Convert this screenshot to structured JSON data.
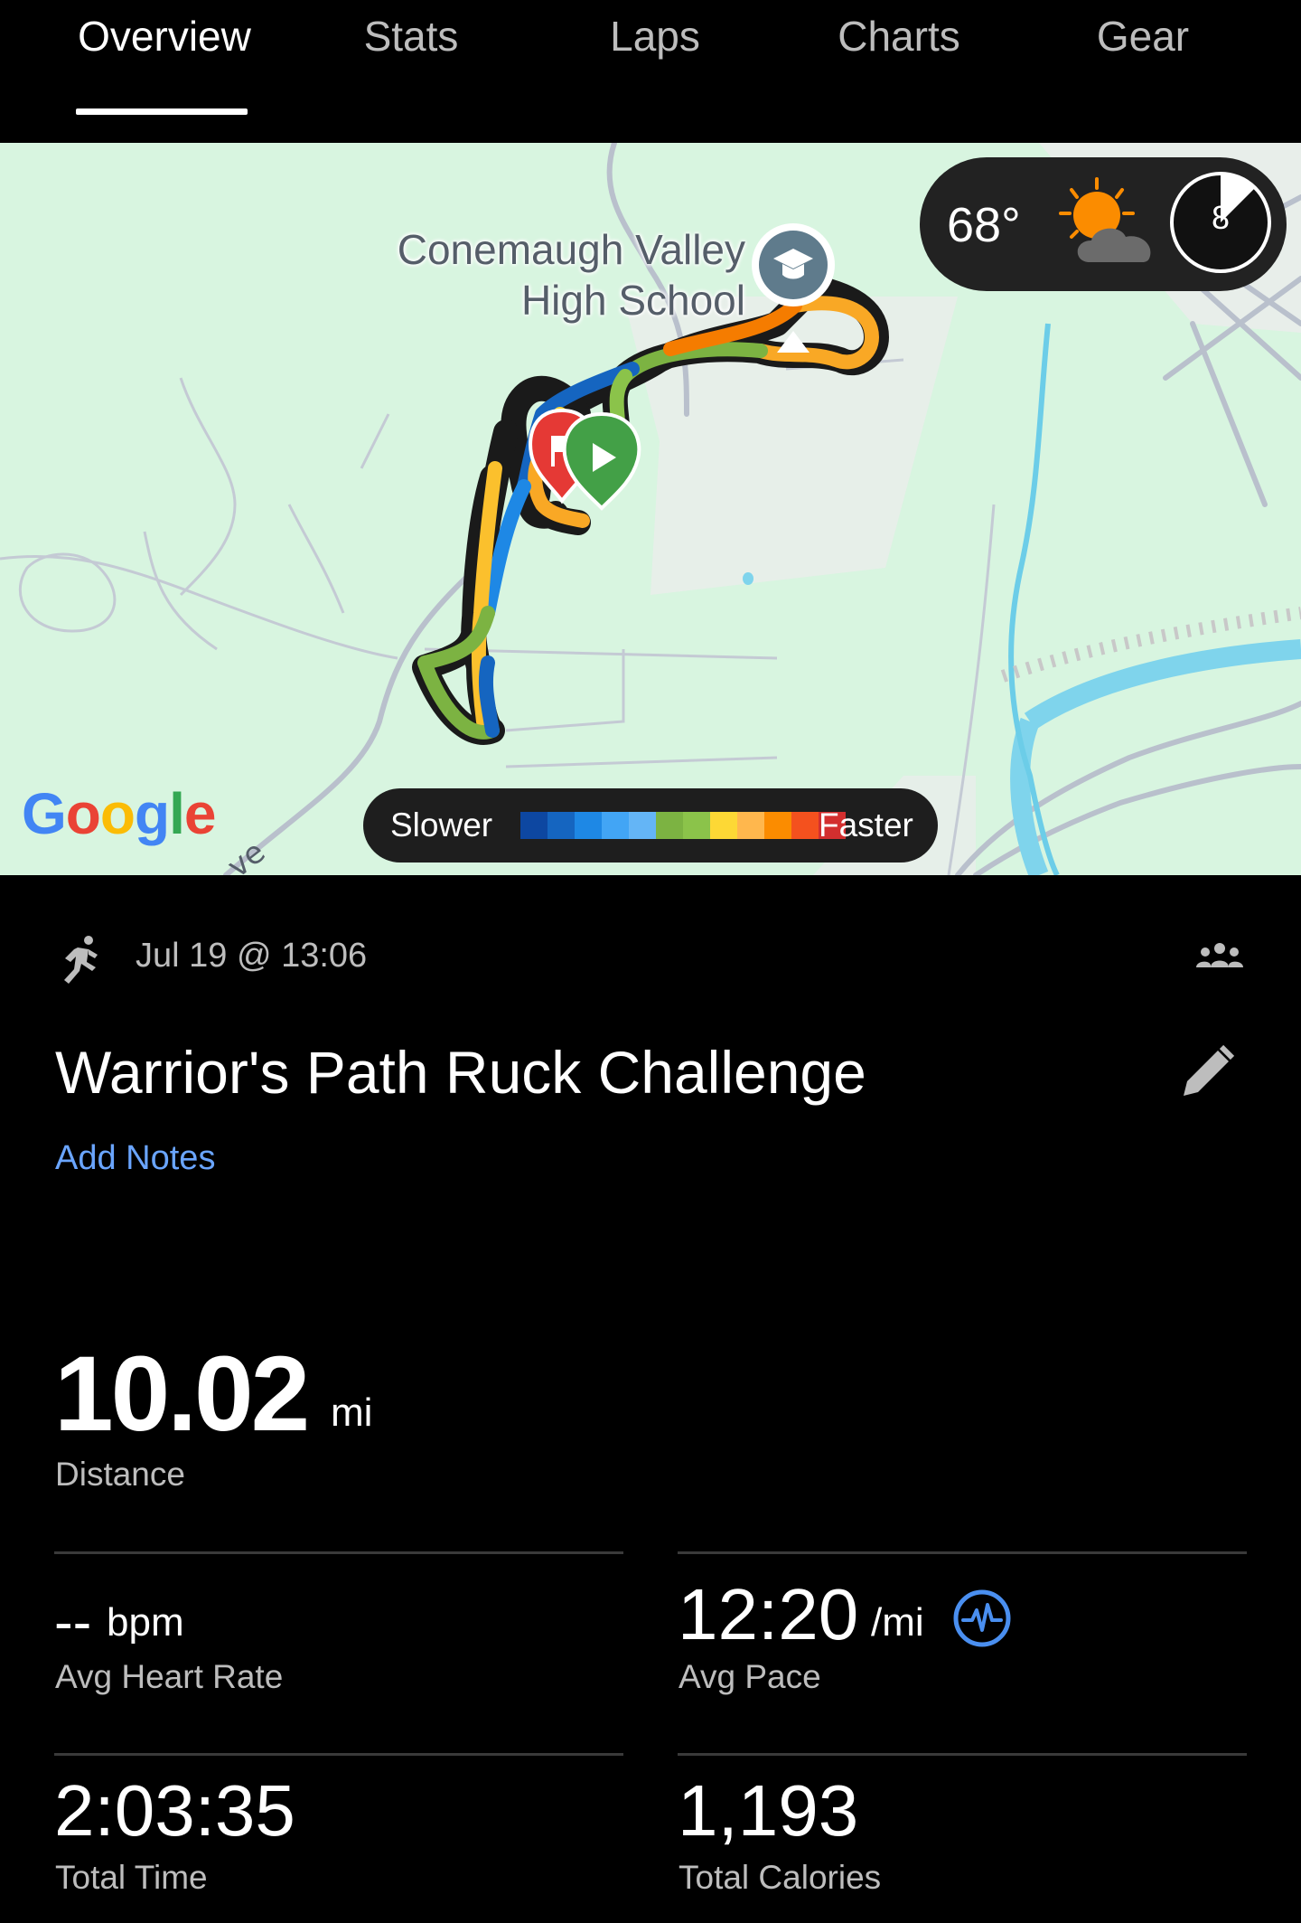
{
  "tabs": [
    {
      "label": "Overview",
      "active": true
    },
    {
      "label": "Stats",
      "active": false
    },
    {
      "label": "Laps",
      "active": false
    },
    {
      "label": "Charts",
      "active": false
    },
    {
      "label": "Gear",
      "active": false
    }
  ],
  "map": {
    "poi_label_line1": "Conemaugh Valley",
    "poi_label_line2": "High School",
    "road_label": "ve",
    "google_logo": "Google",
    "weather": {
      "temperature": "68°",
      "condition_icon": "partly-cloudy-icon",
      "moon_phase": "8"
    },
    "legend": {
      "slower_label": "Slower",
      "faster_label": "Faster",
      "colors": [
        "#0d47a1",
        "#1565c0",
        "#1e88e5",
        "#42a5f5",
        "#64b5f6",
        "#7cb342",
        "#8bc34a",
        "#fdd835",
        "#ffb74d",
        "#fb8c00",
        "#f4511e",
        "#d32f2f"
      ]
    }
  },
  "activity": {
    "type_icon": "running-icon",
    "date": "Jul 19 @ 13:06",
    "title": "Warrior's Path Ruck Challenge",
    "add_notes": "Add Notes"
  },
  "stats": {
    "distance": {
      "value": "10.02",
      "unit": "mi",
      "label": "Distance"
    },
    "avg_heart_rate": {
      "value": "--",
      "unit": "bpm",
      "label": "Avg Heart Rate"
    },
    "avg_pace": {
      "value": "12:20",
      "unit": "/mi",
      "label": "Avg Pace"
    },
    "total_time": {
      "value": "2:03:35",
      "label": "Total Time"
    },
    "total_calories": {
      "value": "1,193",
      "label": "Total Calories"
    }
  },
  "colors": {
    "accent_blue": "#6aa5ff",
    "background": "#000000",
    "map_green": "#d8f5e0"
  }
}
